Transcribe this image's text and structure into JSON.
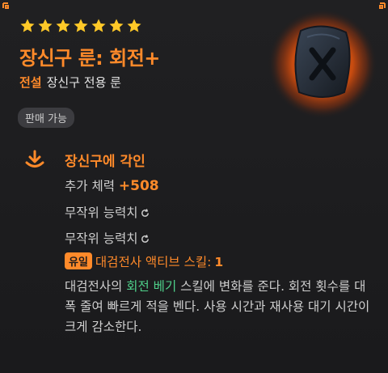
{
  "item": {
    "stars": 7,
    "name": "장신구 룬: 회전+",
    "grade": "전설",
    "type_text": "장신구 전용 룬",
    "sell_badge": "판매 가능",
    "icon": "rune-stone-icon"
  },
  "engrave": {
    "title": "장신구에 각인",
    "icon": "download-arrow-icon",
    "stats": [
      {
        "label": "추가 체력 ",
        "value": "+508"
      },
      {
        "label": "무작위 능력치",
        "reroll_icon": "reroll-icon"
      },
      {
        "label": "무작위 능력치",
        "reroll_icon": "reroll-icon"
      }
    ],
    "unique": {
      "tag": "유일",
      "text": "대검전사 액티브 스킬:",
      "value": "1"
    },
    "description": {
      "before": "대검전사의 ",
      "highlight": "회전 베기",
      "after": " 스킬에 변화를 준다. 회전 횟수를 대폭 줄여 빠르게 적을 벤다. 사용 시간과 재사용 대기 시간이 크게 감소한다."
    }
  },
  "colors": {
    "accent": "#ff8a2a",
    "highlight": "#4fd08a",
    "star": "#ffc928",
    "background": "#1b1b1d"
  }
}
